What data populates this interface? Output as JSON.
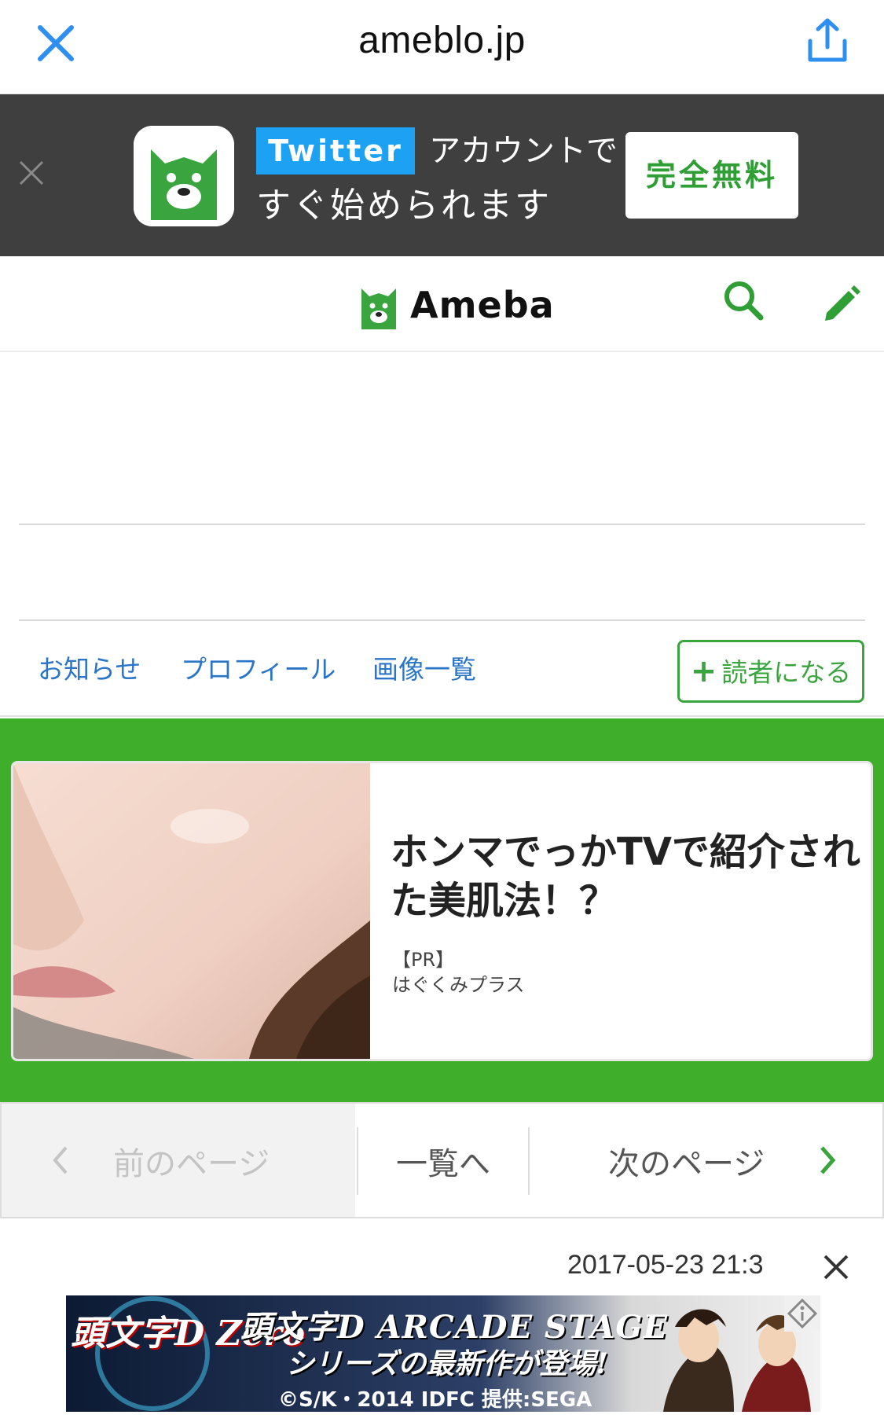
{
  "browser": {
    "domain": "ameblo.jp"
  },
  "app_banner": {
    "twitter_badge": "Twitter",
    "line1": "アカウントで",
    "line2": "すぐ始められます",
    "cta": "完全無料"
  },
  "header": {
    "logo_text": "Ameba"
  },
  "blog_nav": {
    "links": [
      "お知らせ",
      "プロフィール",
      "画像一覧"
    ],
    "follow_label": "読者になる"
  },
  "ad": {
    "title": "ホンマでっかTVで紹介された美肌法！？",
    "pr": "【PR】",
    "sponsor": "はぐくみプラス"
  },
  "pager": {
    "prev": "前のページ",
    "list": "一覧へ",
    "next": "次のページ"
  },
  "post": {
    "date": "2017-05-23 21:3"
  },
  "bottom_ad": {
    "logo": "頭文字D Zero",
    "line1": "頭文字D ARCADE STAGE",
    "line2": "シリーズの最新作が登場!",
    "line3": "©S/K・2014 IDFC 提供:SEGA"
  },
  "colors": {
    "ameba_green": "#3fae2a",
    "link_blue": "#2a75c8",
    "ios_blue": "#2f8ff0",
    "banner_bg": "#3f3f3f"
  }
}
